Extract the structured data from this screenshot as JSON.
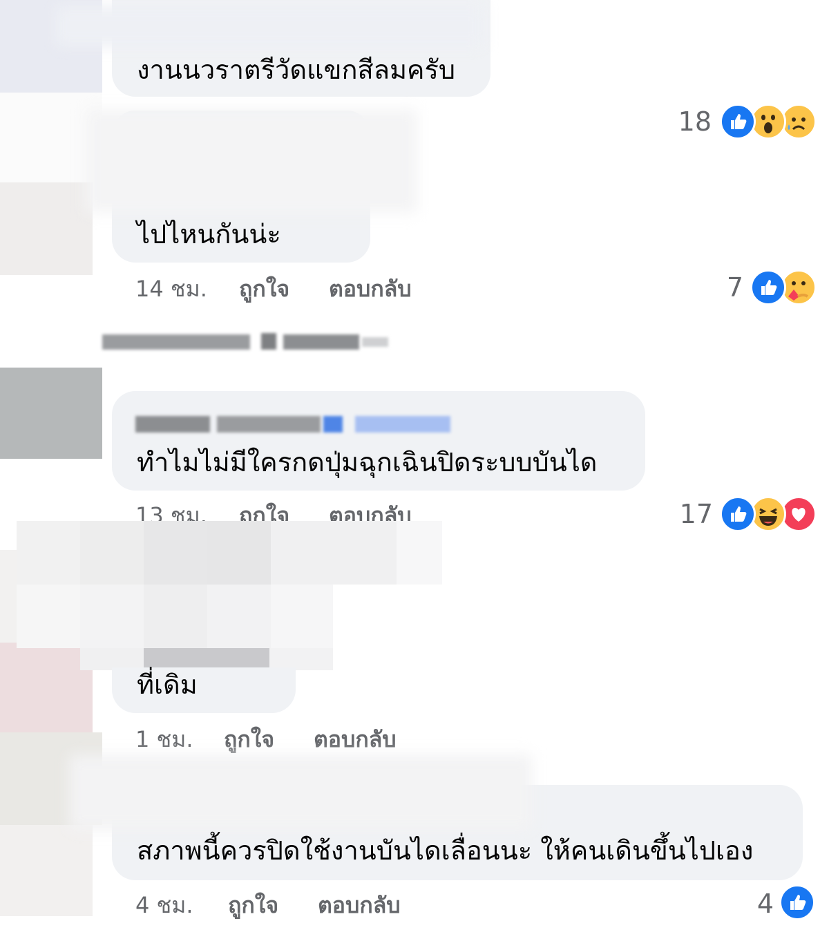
{
  "comments": [
    {
      "text": "งานนวราตรีวัดแขกสีลมครับ",
      "count": "18",
      "reactions": [
        "like-icon",
        "wow-icon",
        "sad-icon"
      ]
    },
    {
      "text": "ไปไหนกันน่ะ",
      "time": "14 ชม.",
      "like": "ถูกใจ",
      "reply": "ตอบกลับ",
      "count": "7",
      "reactions": [
        "like-icon",
        "care-icon"
      ]
    },
    {
      "text": "ทำไมไม่มีใครกดปุ่มฉุกเฉินปิดระบบบันได",
      "time": "13 ชม.",
      "like": "ถูกใจ",
      "reply": "ตอบกลับ",
      "count": "17",
      "reactions": [
        "like-icon",
        "haha-icon",
        "love-icon"
      ]
    },
    {
      "text": "ที่เดิม",
      "time": "1 ชม.",
      "like": "ถูกใจ",
      "reply": "ตอบกลับ"
    },
    {
      "text": "สภาพนี้ควรปิดใช้งานบันไดเลื่อนนะ ให้คนเดินขึ้นไปเอง",
      "time": "4 ชม.",
      "like": "ถูกใจ",
      "reply": "ตอบกลับ",
      "count": "4",
      "reactions": [
        "like-icon"
      ]
    }
  ],
  "colors": {
    "bubble": "#f0f2f5",
    "meta_text": "#65676b",
    "like_blue": "#1877f2",
    "love_red": "#f33e58",
    "emoji_yellow": "#fcc449"
  }
}
